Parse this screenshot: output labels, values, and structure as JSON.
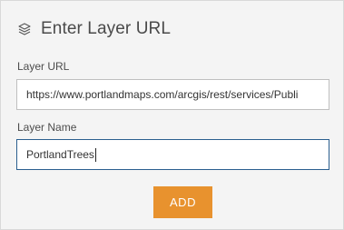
{
  "header": {
    "icon": "layers-icon",
    "title": "Enter Layer URL"
  },
  "layer_url": {
    "label": "Layer URL",
    "value": "https://www.portlandmaps.com/arcgis/rest/services/Publi"
  },
  "layer_name": {
    "label": "Layer Name",
    "value": "PortlandTrees"
  },
  "actions": {
    "add_label": "ADD"
  },
  "colors": {
    "accent": "#e8922e",
    "focus_border": "#2b5f8f",
    "panel_bg": "#f4f4f4"
  }
}
